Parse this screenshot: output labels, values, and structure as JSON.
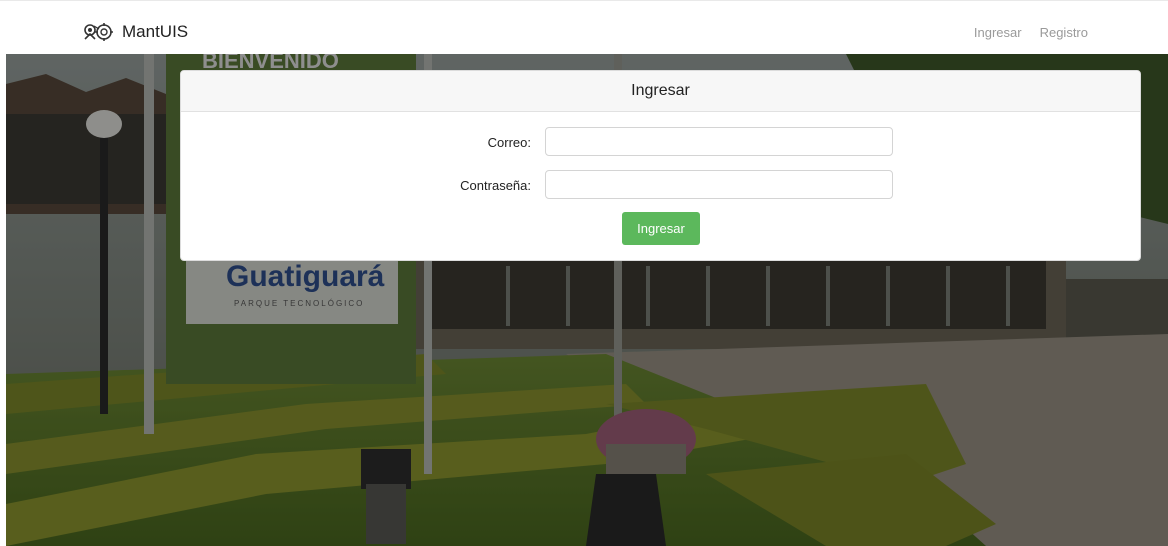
{
  "navbar": {
    "brand_name": "MantUIS",
    "links": [
      {
        "label": "Ingresar"
      },
      {
        "label": "Registro"
      }
    ]
  },
  "background": {
    "sign_text": "Guatiguará",
    "sign_subtext": "PARQUE TECNOLÓGICO",
    "banner_text": "BIENVENIDO"
  },
  "login": {
    "title": "Ingresar",
    "email_label": "Correo:",
    "email_value": "",
    "password_label": "Contraseña:",
    "password_value": "",
    "submit_label": "Ingresar"
  },
  "colors": {
    "accent": "#5cb85c",
    "nav_link": "#9a9a9a"
  }
}
